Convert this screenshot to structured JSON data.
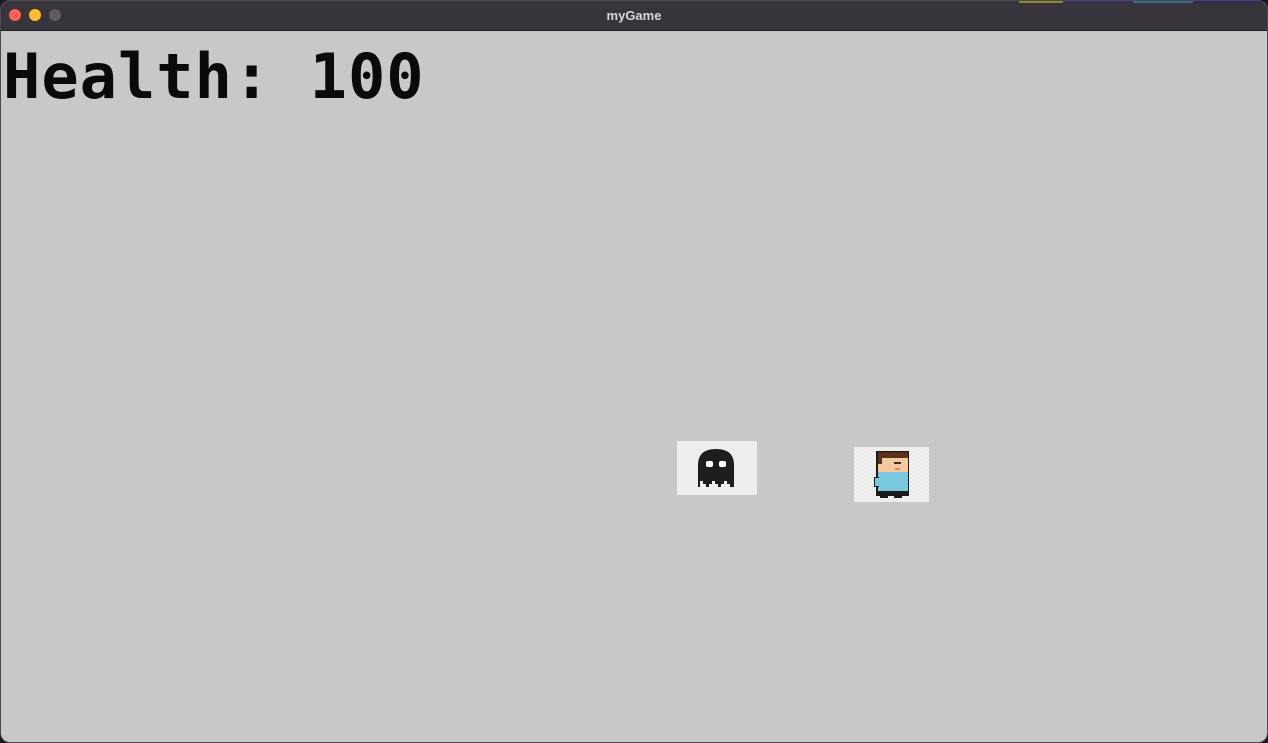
{
  "window": {
    "title": "myGame",
    "controls": [
      "close",
      "minimize",
      "maximize"
    ]
  },
  "hud": {
    "health_text": "Health: 100",
    "health_value": 100
  },
  "sprites": {
    "enemy": {
      "icon": "ghost-icon",
      "color": "#1e1e1e"
    },
    "player": {
      "icon": "player-character-icon",
      "shirt_color": "#78c8e0",
      "hair_color": "#5a3218",
      "skin_color": "#f5c9a0"
    }
  },
  "colors": {
    "canvas_background": "#c8c8c8",
    "titlebar": "#37353b",
    "health_text": "#0a0a0a"
  }
}
